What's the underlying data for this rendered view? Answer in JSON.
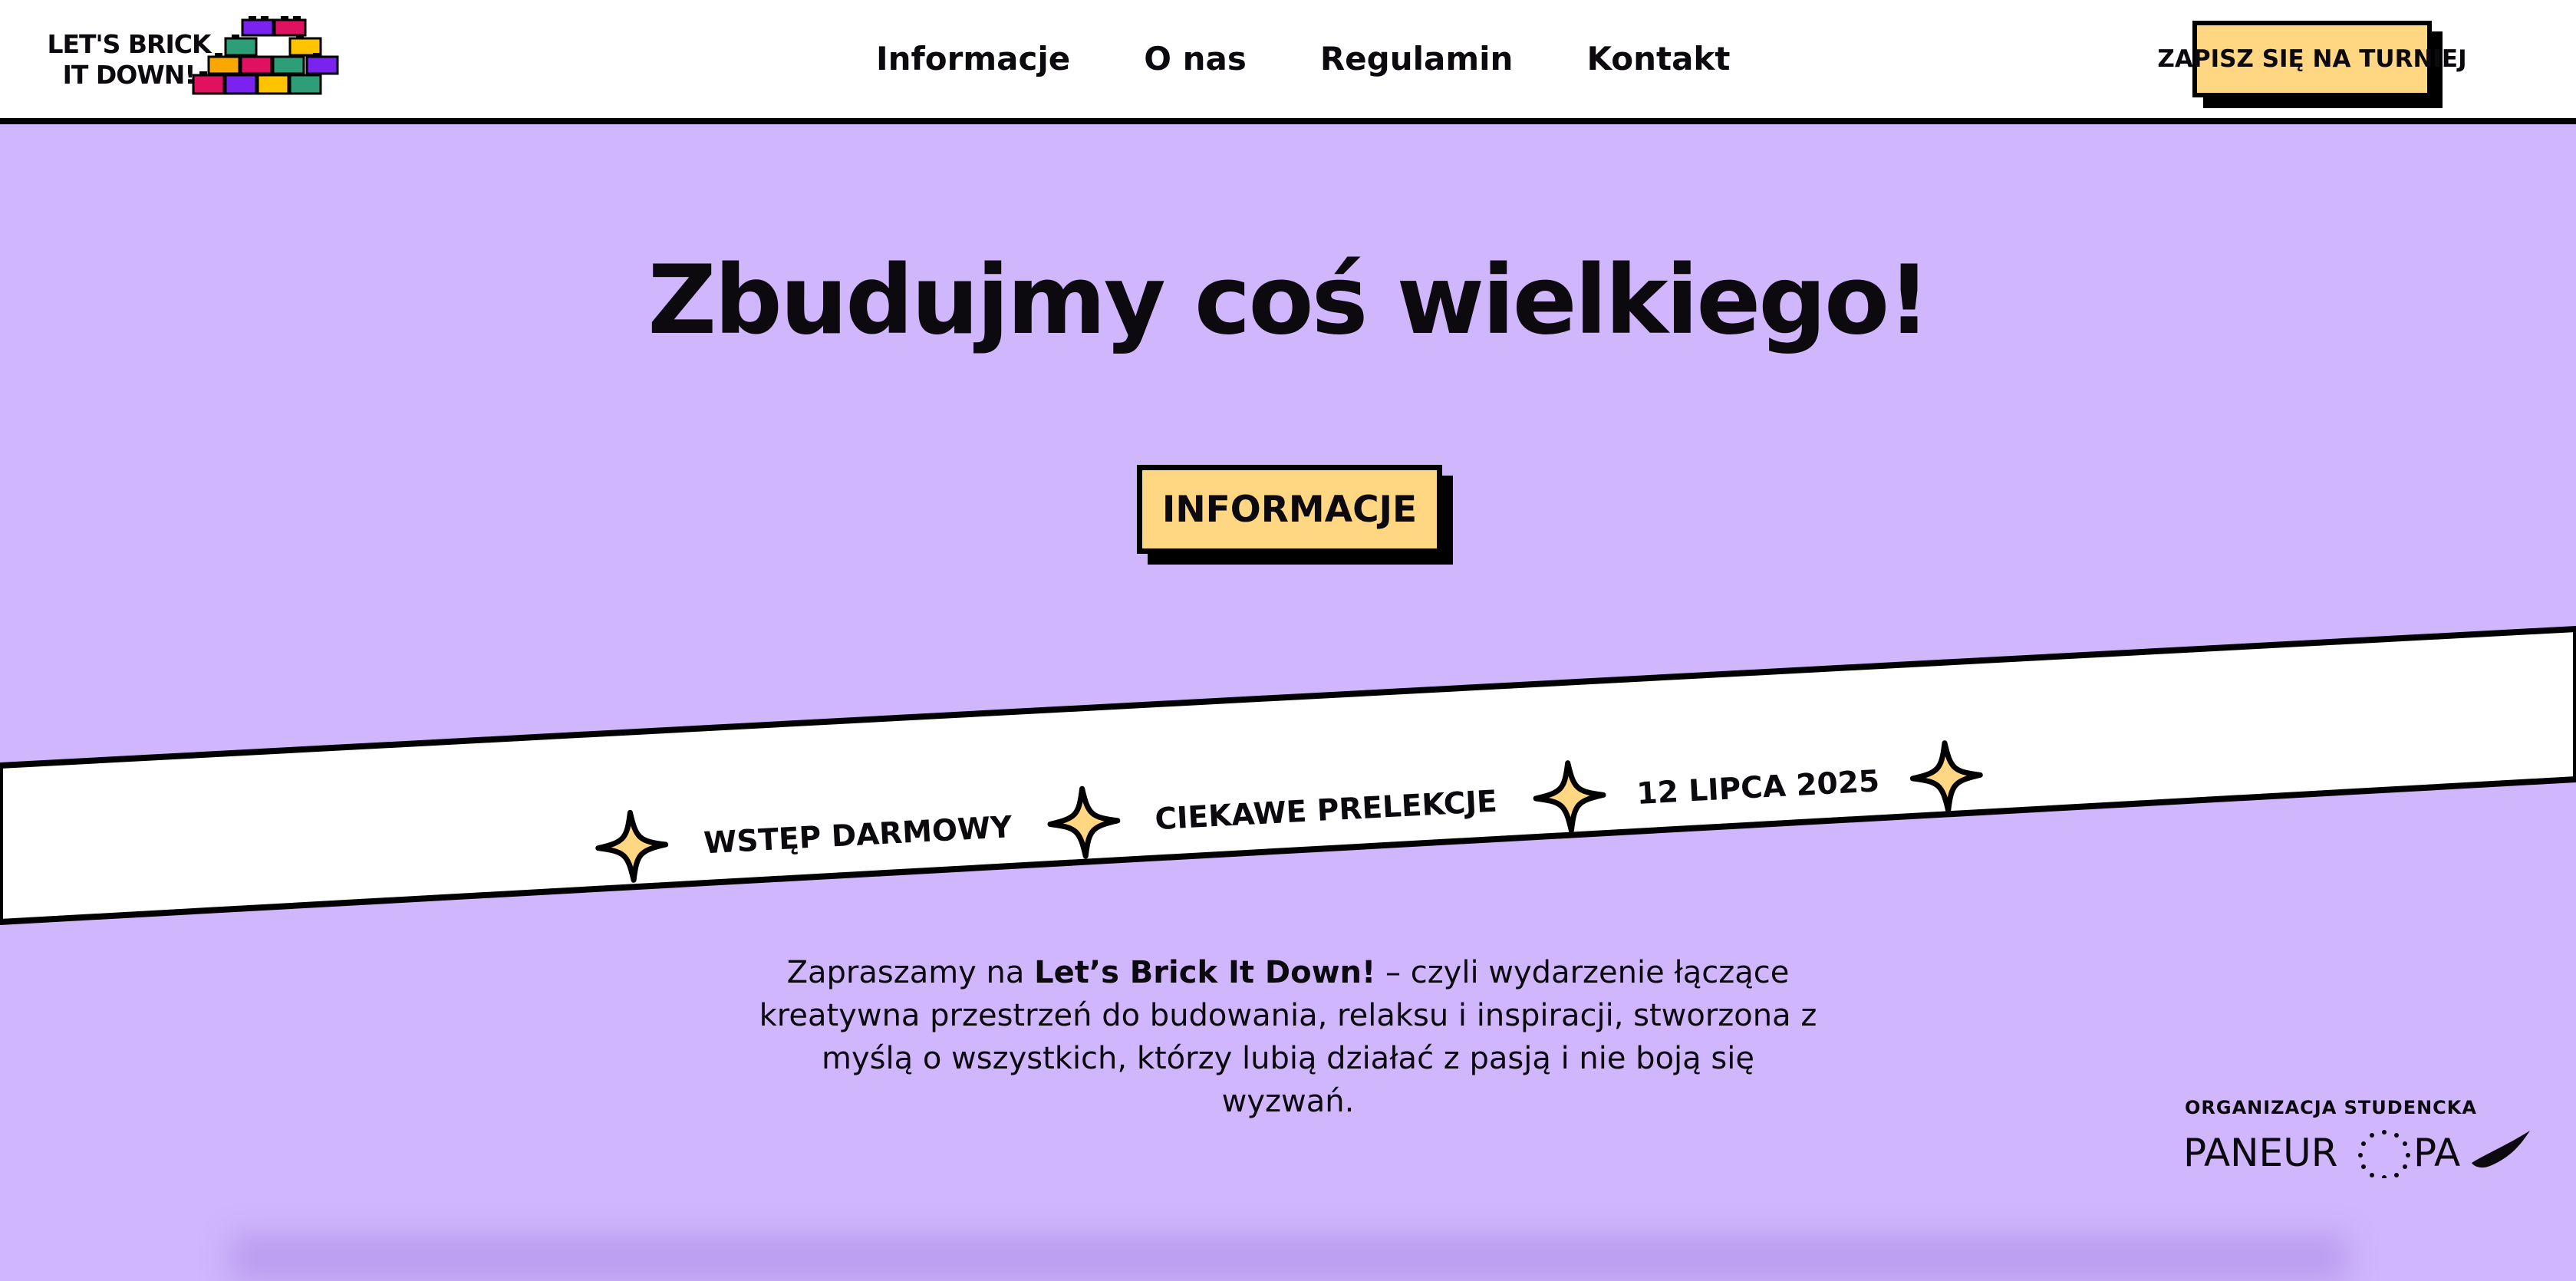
{
  "header": {
    "logo_line1": "LET'S BRICK",
    "logo_line2": "IT DOWN!",
    "nav": [
      "Informacje",
      "O nas",
      "Regulamin",
      "Kontakt"
    ],
    "cta_label": "ZAPISZ SIĘ NA TURNIEJ"
  },
  "hero": {
    "title": "Zbudujmy coś wielkiego!",
    "button_label": "INFORMACJE"
  },
  "ribbon": {
    "items": [
      "WSTĘP DARMOWY",
      "CIEKAWE PRELEKCJE",
      "12 LIPCA 2025"
    ]
  },
  "intro": {
    "before": "Zapraszamy na ",
    "bold": "Let’s Brick It Down!",
    "after": " – czyli wydarzenie łączące kreatywna przestrzeń do budowania, relaksu i inspiracji, stworzona z myślą o wszystkich, którzy lubią działać z pasją i nie boją się wyzwań."
  },
  "org": {
    "label": "ORGANIZACJA STUDENCKA",
    "name_left": "PANEUR",
    "name_right": "PA"
  },
  "colors": {
    "background": "#d0b6fd",
    "accent_yellow": "#ffd783",
    "text": "#0c0a0e",
    "brick_purple": "#7a22f0",
    "brick_red": "#e0115f",
    "brick_green": "#2e9e78",
    "brick_orange": "#f8a800",
    "brick_yellow": "#ffc300"
  }
}
